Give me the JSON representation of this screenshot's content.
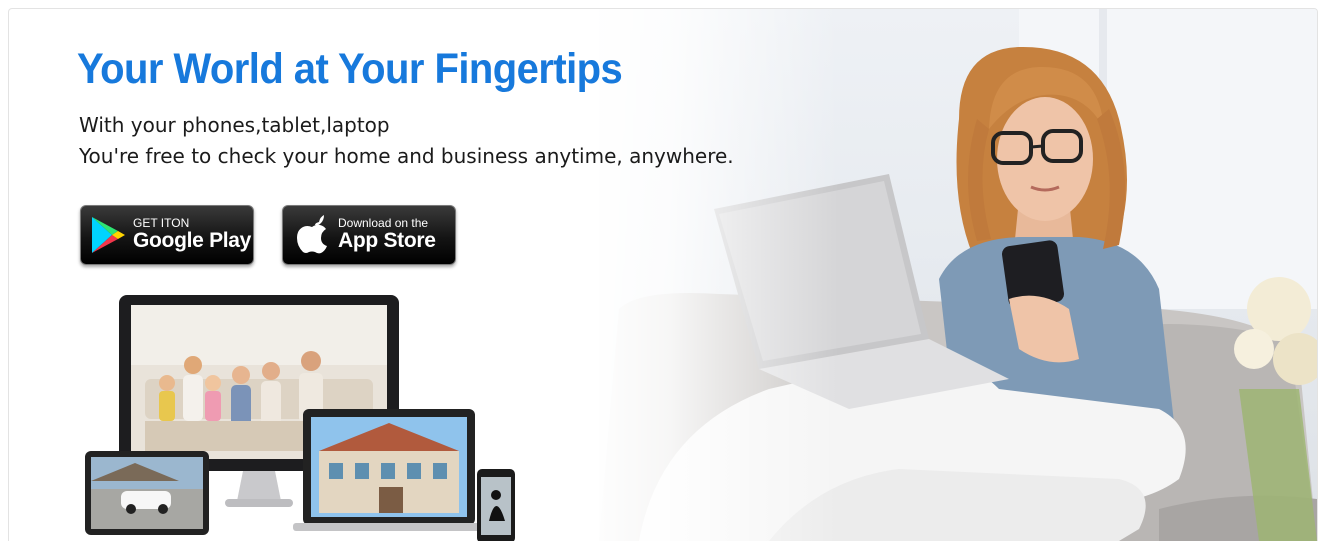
{
  "hero": {
    "title": "Your World at Your Fingertips",
    "subtitle_line1": "With your phones,tablet,laptop",
    "subtitle_line2": "You're free to check your home and business anytime, anywhere."
  },
  "badges": {
    "google_play": {
      "small": "GET ITON",
      "big": "Google Play",
      "icon": "google-play-icon"
    },
    "app_store": {
      "small": "Download on the",
      "big": "App Store",
      "icon": "apple-icon"
    }
  },
  "colors": {
    "title": "#1779dc",
    "text": "#1b1b1b",
    "badge_bg": "#000000"
  }
}
